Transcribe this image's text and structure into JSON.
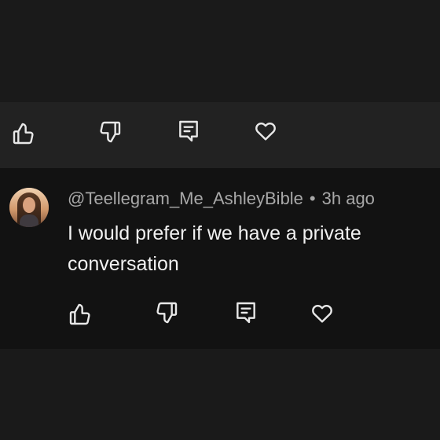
{
  "previous_comment_actions": [
    {
      "name": "like-button",
      "icon": "thumbs-up-icon"
    },
    {
      "name": "dislike-button",
      "icon": "thumbs-down-icon"
    },
    {
      "name": "reply-button",
      "icon": "reply-icon"
    },
    {
      "name": "heart-button",
      "icon": "heart-icon"
    }
  ],
  "comment": {
    "author": "@Teellegram_Me_AshleyBible",
    "separator": "•",
    "time": "3h ago",
    "text": "I would prefer if we have a private conversation"
  },
  "comment_actions": [
    {
      "name": "like-button",
      "icon": "thumbs-up-icon"
    },
    {
      "name": "dislike-button",
      "icon": "thumbs-down-icon"
    },
    {
      "name": "reply-button",
      "icon": "reply-icon"
    },
    {
      "name": "heart-button",
      "icon": "heart-icon"
    }
  ],
  "colors": {
    "page_background": "#1a1a1a",
    "actions_bar_background": "#222222",
    "comment_background": "#121212",
    "text_primary": "#f1f1f1",
    "text_secondary": "#a8a8a8",
    "icon_stroke": "#e8e8e8"
  }
}
